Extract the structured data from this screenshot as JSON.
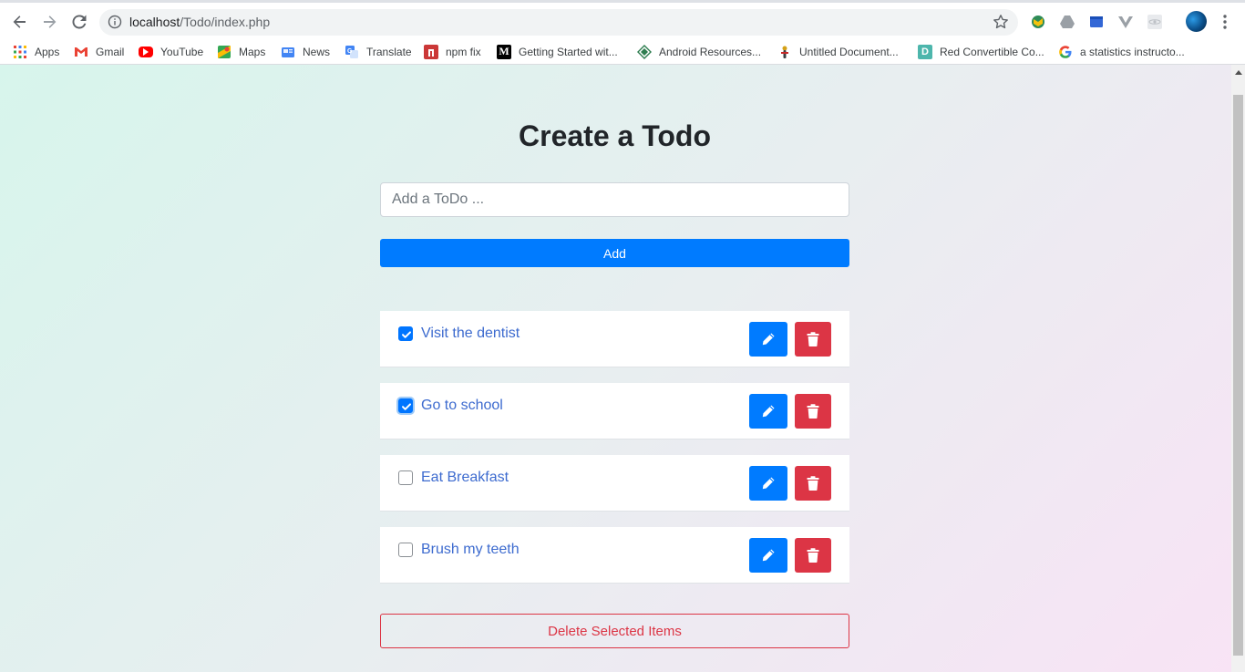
{
  "browser": {
    "url_host": "localhost",
    "url_path": "/Todo/index.php"
  },
  "bookmarks": [
    {
      "label": "Apps",
      "icon": "apps-grid-icon",
      "color": "#4285f4"
    },
    {
      "label": "Gmail",
      "icon": "gmail-icon",
      "color": "#ea4335"
    },
    {
      "label": "YouTube",
      "icon": "youtube-icon",
      "color": "#ff0000"
    },
    {
      "label": "Maps",
      "icon": "maps-icon",
      "color": "#34a853"
    },
    {
      "label": "News",
      "icon": "news-icon",
      "color": "#4285f4"
    },
    {
      "label": "Translate",
      "icon": "translate-icon",
      "color": "#4285f4"
    },
    {
      "label": "npm fix",
      "icon": "npm-icon",
      "color": "#cb3837"
    },
    {
      "label": "Getting Started wit...",
      "icon": "medium-icon",
      "color": "#000000"
    },
    {
      "label": "Android Resources...",
      "icon": "android-resources-icon",
      "color": "#2e7d4f"
    },
    {
      "label": "Untitled Document...",
      "icon": "document-icon",
      "color": "#d4a017"
    },
    {
      "label": "Red Convertible Co...",
      "icon": "d-icon",
      "color": "#4db6ac"
    },
    {
      "label": "a statistics instructo...",
      "icon": "google-icon",
      "color": "#4285f4"
    }
  ],
  "page": {
    "title": "Create a Todo",
    "input_placeholder": "Add a ToDo ...",
    "input_value": "",
    "add_label": "Add",
    "delete_selected_label": "Delete Selected Items"
  },
  "todos": [
    {
      "label": "Visit the dentist",
      "checked": true
    },
    {
      "label": "Go to school",
      "checked": true
    },
    {
      "label": "Eat Breakfast",
      "checked": false
    },
    {
      "label": "Brush my teeth",
      "checked": false
    }
  ],
  "colors": {
    "primary": "#007bff",
    "danger": "#dc3545",
    "todo_text": "#3d6bcf"
  }
}
